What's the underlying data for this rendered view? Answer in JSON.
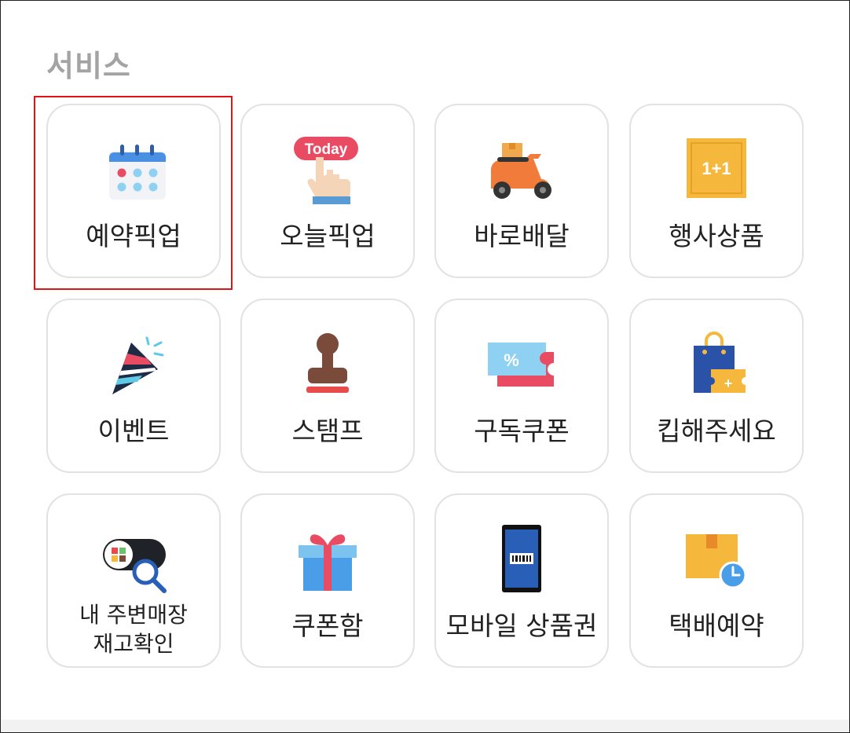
{
  "section": {
    "title": "서비스"
  },
  "services": [
    {
      "label": "예약픽업",
      "icon": "calendar-icon"
    },
    {
      "label": "오늘픽업",
      "icon": "today-tap-icon"
    },
    {
      "label": "바로배달",
      "icon": "scooter-icon"
    },
    {
      "label": "행사상품",
      "icon": "one-plus-one-icon",
      "icon_text": "1+1"
    },
    {
      "label": "이벤트",
      "icon": "party-popper-icon"
    },
    {
      "label": "스탬프",
      "icon": "stamp-icon"
    },
    {
      "label": "구독쿠폰",
      "icon": "percent-coupon-icon",
      "icon_text": "%"
    },
    {
      "label": "킵해주세요",
      "icon": "shopping-bag-ticket-icon"
    },
    {
      "label": "내 주변매장\n재고확인",
      "icon": "nearby-stock-search-icon"
    },
    {
      "label": "쿠폰함",
      "icon": "gift-box-icon"
    },
    {
      "label": "모바일 상품권",
      "icon": "mobile-barcode-icon"
    },
    {
      "label": "택배예약",
      "icon": "parcel-clock-icon"
    }
  ],
  "badge": {
    "today_text": "Today"
  },
  "colors": {
    "title": "#a3a3a3",
    "tile_border": "#e2e2e2",
    "highlight": "#e01414",
    "label": "#222222"
  }
}
